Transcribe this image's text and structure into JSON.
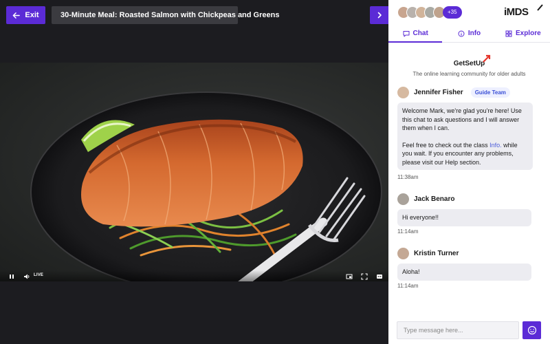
{
  "header": {
    "exit_label": "Exit",
    "class_title": "30-Minute Meal: Roasted Salmon with Chickpeas and Greens"
  },
  "player": {
    "live_label": "LIVE"
  },
  "panel": {
    "participants_more": "+35",
    "app_logo": "iMDS",
    "tabs": [
      {
        "label": "Chat",
        "icon": "chat-icon"
      },
      {
        "label": "Info",
        "icon": "info-icon"
      },
      {
        "label": "Explore",
        "icon": "grid-icon"
      }
    ],
    "brand_name": "GetSetUp",
    "brand_tagline": "The online learning community for older adults"
  },
  "messages": [
    {
      "author": "Jennifer Fisher",
      "badge": "Guide Team",
      "p1": "Welcome Mark, we're glad you're here! Use this chat to ask questions and I will answer them when I can.",
      "p2_before": "Feel free to check out the class ",
      "p2_link": "Info.",
      "p2_after": " while you wait. If you encounter any problems, please visit our Help section.",
      "time": "11:38am"
    },
    {
      "author": "Jack Benaro",
      "text": "Hi everyone!!",
      "time": "11:14am"
    },
    {
      "author": "Kristin Turner",
      "text": "Aloha!",
      "time": "11:14am"
    }
  ],
  "compose": {
    "placeholder": "Type message here..."
  },
  "colors": {
    "accent": "#5b2bd6",
    "link": "#4a5bd9",
    "bubble": "#ececf1"
  }
}
